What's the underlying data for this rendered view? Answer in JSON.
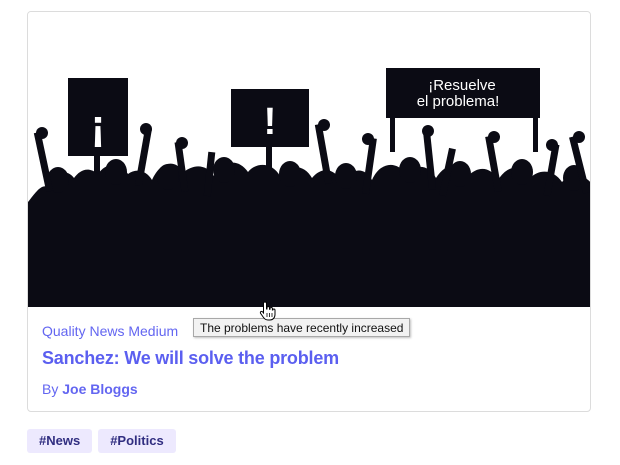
{
  "card": {
    "image": {
      "sign_left": "¡",
      "sign_middle": "!",
      "banner_line1": "¡Resuelve",
      "banner_line2": "el problema!",
      "colors": {
        "silhouette": "#0b0b14",
        "sign_text": "#ffffff"
      }
    },
    "source": "Quality News Medium",
    "headline": "Sanchez: We will solve the problem",
    "byline_prefix": "By ",
    "author": "Joe Bloggs"
  },
  "tooltip": "The problems have recently increased",
  "cursor": "hand-pointer-icon",
  "tags": [
    "#News",
    "#Politics"
  ],
  "colors": {
    "accent": "#6366f1",
    "tag_bg": "#ede9fe",
    "tag_text": "#312e81"
  }
}
